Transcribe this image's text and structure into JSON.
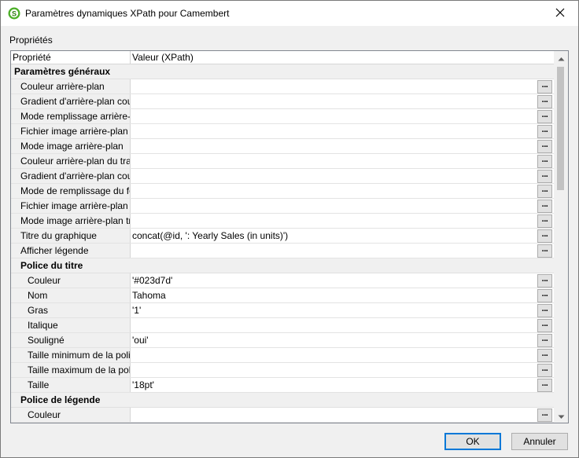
{
  "window": {
    "title": "Paramètres dynamiques XPath pour Camembert",
    "app_icon": "altova-xpath-icon",
    "close_icon": "close-icon"
  },
  "properties": {
    "group_label": "Propriétés",
    "header": {
      "property": "Propriété",
      "value": "Valeur (XPath)"
    },
    "edit_button_label": "...",
    "groups": [
      {
        "name": "Paramètres généraux",
        "rows": [
          {
            "name": "Couleur arrière-plan",
            "value": ""
          },
          {
            "name": "Gradient d'arrière-plan couleur",
            "value": ""
          },
          {
            "name": "Mode remplissage arrière-plan",
            "value": ""
          },
          {
            "name": "Fichier image arrière-plan",
            "value": ""
          },
          {
            "name": "Mode image arrière-plan",
            "value": ""
          },
          {
            "name": "Couleur arrière-plan du tracé",
            "value": ""
          },
          {
            "name": "Gradient d'arrière-plan couleur",
            "value": ""
          },
          {
            "name": "Mode de remplissage du fond",
            "value": ""
          },
          {
            "name": "Fichier image arrière-plan",
            "value": ""
          },
          {
            "name": "Mode image arrière-plan tracé",
            "value": ""
          },
          {
            "name": "Titre du graphique",
            "value": "concat(@id, ': Yearly Sales (in units)')"
          },
          {
            "name": "Afficher légende",
            "value": ""
          }
        ]
      },
      {
        "name": "Police du titre",
        "rows": [
          {
            "name": "Couleur",
            "value": "'#023d7d'"
          },
          {
            "name": "Nom",
            "value": "Tahoma"
          },
          {
            "name": "Gras",
            "value": "'1'"
          },
          {
            "name": "Italique",
            "value": ""
          },
          {
            "name": "Souligné",
            "value": "'oui'"
          },
          {
            "name": "Taille minimum de la police",
            "value": ""
          },
          {
            "name": "Taille maximum de la police",
            "value": ""
          },
          {
            "name": "Taille",
            "value": "'18pt'"
          }
        ]
      },
      {
        "name": "Police de légende",
        "rows": [
          {
            "name": "Couleur",
            "value": ""
          }
        ]
      }
    ]
  },
  "buttons": {
    "ok": "OK",
    "cancel": "Annuler"
  }
}
